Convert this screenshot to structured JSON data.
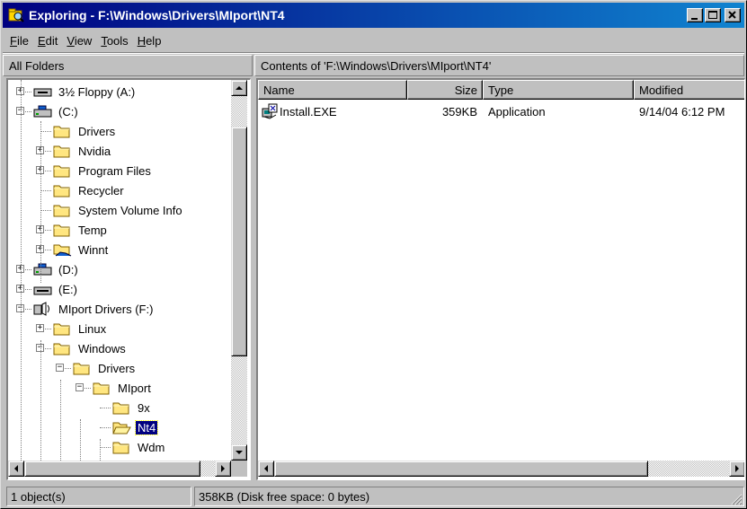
{
  "window": {
    "title": "Exploring - F:\\Windows\\Drivers\\MIport\\NT4",
    "title_bar_color": "#000080"
  },
  "menu": [
    {
      "label": "File",
      "mnemonic": "F",
      "rest": "ile"
    },
    {
      "label": "Edit",
      "mnemonic": "E",
      "rest": "dit"
    },
    {
      "label": "View",
      "mnemonic": "V",
      "rest": "iew"
    },
    {
      "label": "Tools",
      "mnemonic": "T",
      "rest": "ools"
    },
    {
      "label": "Help",
      "mnemonic": "H",
      "rest": "elp"
    }
  ],
  "tree_header": "All Folders",
  "contents_header": "Contents of 'F:\\Windows\\Drivers\\MIport\\NT4'",
  "tree": [
    {
      "label": "3½ Floppy (A:)",
      "icon": "floppy-drive-icon",
      "expander": "+"
    },
    {
      "label": "(C:)",
      "icon": "hard-drive-icon",
      "expander": "-"
    },
    {
      "label": "Drivers",
      "icon": "folder-icon",
      "expander": ""
    },
    {
      "label": "Nvidia",
      "icon": "folder-icon",
      "expander": "+"
    },
    {
      "label": "Program Files",
      "icon": "folder-icon",
      "expander": "+"
    },
    {
      "label": "Recycler",
      "icon": "folder-icon",
      "expander": ""
    },
    {
      "label": "System Volume Info",
      "icon": "folder-icon",
      "expander": ""
    },
    {
      "label": "Temp",
      "icon": "folder-icon",
      "expander": "+"
    },
    {
      "label": "Winnt",
      "icon": "shared-folder-icon",
      "expander": "+"
    },
    {
      "label": "(D:)",
      "icon": "hard-drive-icon",
      "expander": "+"
    },
    {
      "label": "(E:)",
      "icon": "removable-drive-icon",
      "expander": "+"
    },
    {
      "label": "MIport Drivers (F:)",
      "icon": "network-drive-icon",
      "expander": "-"
    },
    {
      "label": "Linux",
      "icon": "folder-icon",
      "expander": "+"
    },
    {
      "label": "Windows",
      "icon": "folder-icon",
      "expander": "-"
    },
    {
      "label": "Drivers",
      "icon": "folder-icon",
      "expander": "-"
    },
    {
      "label": "MIport",
      "icon": "folder-icon",
      "expander": "-"
    },
    {
      "label": "9x",
      "icon": "folder-icon",
      "expander": ""
    },
    {
      "label": "Nt4",
      "icon": "open-folder-icon",
      "expander": "",
      "selected": true
    },
    {
      "label": "Wdm",
      "icon": "folder-icon",
      "expander": ""
    }
  ],
  "columns": {
    "name": "Name",
    "size": "Size",
    "type": "Type",
    "modified": "Modified"
  },
  "files": [
    {
      "name": "Install.EXE",
      "size": "359KB",
      "type": "Application",
      "modified": "9/14/04 6:12 PM",
      "icon": "setup-exe-icon"
    }
  ],
  "status": {
    "objects": "1 object(s)",
    "disk": "358KB (Disk free space: 0 bytes)"
  }
}
